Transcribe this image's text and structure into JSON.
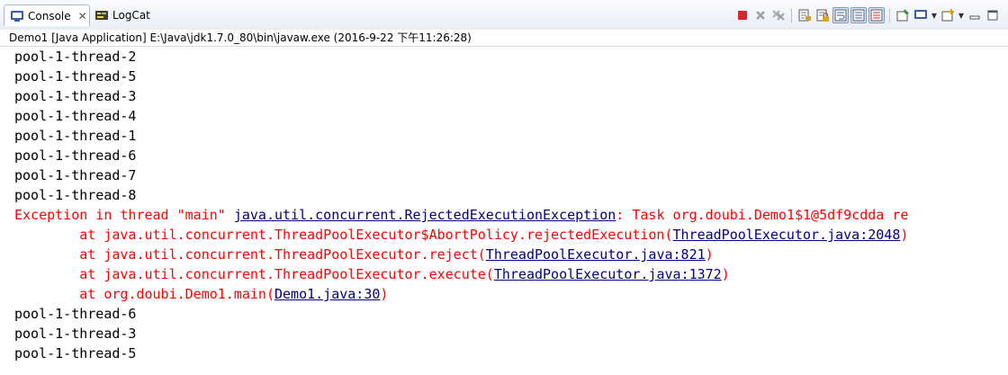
{
  "tabs": {
    "console_label": "Console",
    "logcat_label": "LogCat"
  },
  "info": {
    "launch_text": "Demo1 [Java Application] E:\\Java\\jdk1.7.0_80\\bin\\javaw.exe (2016-9-22 下午11:26:28)"
  },
  "output": {
    "lines_before": [
      "pool-1-thread-2",
      "pool-1-thread-5",
      "pool-1-thread-3",
      "pool-1-thread-4",
      "pool-1-thread-1",
      "pool-1-thread-6",
      "pool-1-thread-7",
      "pool-1-thread-8"
    ],
    "exception": {
      "prefix": "Exception in thread \"main\" ",
      "class_link": "java.util.concurrent.RejectedExecutionException",
      "message": ": Task org.doubi.Demo1$1@5df9cdda re"
    },
    "stack": [
      {
        "text": "\tat java.util.concurrent.ThreadPoolExecutor$AbortPolicy.rejectedExecution(",
        "link": "ThreadPoolExecutor.java:2048",
        "end": ")"
      },
      {
        "text": "\tat java.util.concurrent.ThreadPoolExecutor.reject(",
        "link": "ThreadPoolExecutor.java:821",
        "end": ")"
      },
      {
        "text": "\tat java.util.concurrent.ThreadPoolExecutor.execute(",
        "link": "ThreadPoolExecutor.java:1372",
        "end": ")"
      },
      {
        "text": "\tat org.doubi.Demo1.main(",
        "link": "Demo1.java:30",
        "end": ")"
      }
    ],
    "lines_after": [
      "pool-1-thread-6",
      "pool-1-thread-3",
      "pool-1-thread-5"
    ]
  },
  "icons": {
    "console": "console-icon",
    "logcat": "logcat-icon",
    "terminate": "terminate-icon",
    "remove_launch": "remove-launch-icon",
    "remove_all": "remove-all-terminated-icon",
    "clear": "clear-console-icon",
    "scroll_lock": "scroll-lock-icon",
    "word_wrap": "word-wrap-icon",
    "show_stdout": "show-stdout-icon",
    "show_stderr": "show-stderr-icon",
    "pin": "pin-console-icon",
    "display_console": "display-console-icon",
    "open_console": "open-console-icon",
    "minimize": "minimize-icon",
    "maximize": "maximize-icon"
  },
  "colors": {
    "stderr": "#ff0000",
    "link": "#000080",
    "stdout": "#000000"
  }
}
